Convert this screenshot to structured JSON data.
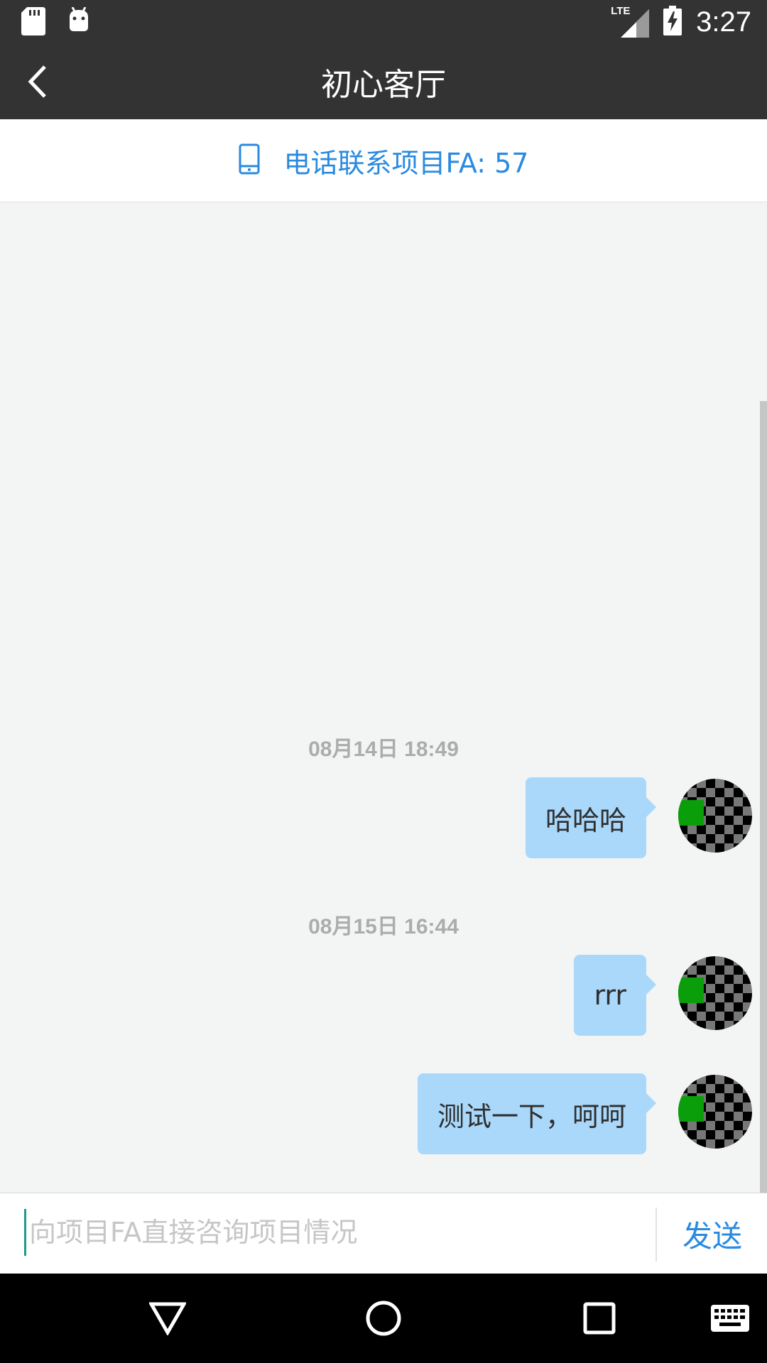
{
  "status_bar": {
    "time": "3:27",
    "network_label": "LTE",
    "icons": [
      "sd-card-icon",
      "android-debug-icon",
      "lte-signal-icon",
      "battery-charging-icon"
    ]
  },
  "header": {
    "title": "初心客厅",
    "back_icon": "chevron-left-icon"
  },
  "phone_banner": {
    "icon": "mobile-phone-icon",
    "text": "电话联系项目FA: 57",
    "color": "#2a8ae0"
  },
  "chat": {
    "groups": [
      {
        "timestamp": "08月14日 18:49",
        "messages": [
          {
            "text": "哈哈哈",
            "sender": "me"
          }
        ]
      },
      {
        "timestamp": "08月15日 16:44",
        "messages": [
          {
            "text": "rrr",
            "sender": "me"
          },
          {
            "text": "测试一下，呵呵",
            "sender": "me"
          }
        ]
      }
    ],
    "bubble_color": "#aad8fb"
  },
  "composer": {
    "placeholder": "向项目FA直接咨询项目情况",
    "value": "",
    "send_label": "发送"
  },
  "nav_bar": {
    "buttons": [
      "back-triangle-icon",
      "home-circle-icon",
      "recents-square-icon",
      "keyboard-icon"
    ]
  }
}
